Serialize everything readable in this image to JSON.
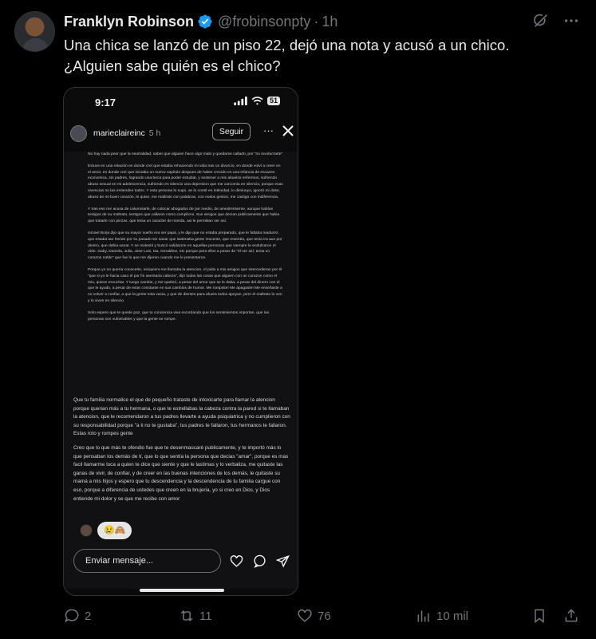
{
  "tweet": {
    "author_name": "Franklyn Robinson",
    "handle": "@frobinsonpty",
    "separator": "·",
    "time": "1h",
    "text_line1": "Una chica se lanzó de un piso 22, dejó una nota y acusó a un chico.",
    "text_line2": "¿Alguien sabe quién es el chico?"
  },
  "story": {
    "status_time": "9:17",
    "battery": "51",
    "username": "marieclaireinc",
    "time": "5 h",
    "follow_label": "Seguir",
    "more_label": "···",
    "note_paragraphs": [
      "No hay nada peor que la neutralidad, saber que alguien hace algo malo y quedarse callado, por \"no involucrarte\"",
      "Estuve en una relación en donde creí que estaba rehaciendo mi vida tras un divorcio, en donde volví a creer en el amor, en donde creí que iniciaba un nuevo capítulo despues de haber crecido en una infancia de escazes economica, sin padres, logrando una beca para poder estudiar, y sostener a mis abuelos enfermos, sufriendo abuso sexual en mi adolescencia, sufriendo en silencio una depresion que me carcomia en silencio, porque esas vivencias no las entienden todos. Y esta persona lo supo, se lo conté en intimidad, lo diminuyo, ignoró mi dolor, abuso de mi buen corazón, le quise, me maltrato con palabras, con malos gestos, me castigo con indiferencia.",
      "Y tras eso me acusa de calumniarle, de colocar abogados de por medio, de amedrentarme, aunque habían testigos de su maltrato, testigos que callaron como complices. Sus amigos que decian publicamente que habia que tratarle con pinzas, que tenia un caracter de mierda, asi le permitian ser así.",
      "Ismael Borja dijo que su mayor sueño era ser papá, y le dije que no estaba preparado, que le faltaba madurez, que estaba tan herido por su pasado sin sanar que lastimaba gente inocente, que resentía, que tenia ira aun por dentro, que debia sanar. Y se molestó y buscó validacion en aquellas personas que siempre le endulzaron el oído. Gaby, Daniela, Julia, Jose Luis, Isa, Geraldine, etc porque para ellos a pesar de \"él ser así, tenia un corazon noble\" que fue lo que me dijeron cuando me lo presentaron.",
      "Porque yo no quería conocerle, nisiquiera me llamaba la atencion, el pidio a mis amigos que intercedieran por él \"que si yo le hacia caso el por fin asentaria cabeza\", dijo todas las cosas que alguien con un corazon como el mio, quiere escuchar. Y luego cambio, y me quebró, a pesar del amor que se le daba, a pesar del dinero con el que le ayudo, a pesar de estar constante en sus cambios de humor. Me rompiste! Me apagaste! Me enseñaste a no volver a confiar, a que la gente esta vacia, y que de dientes para afuera todos apoyan, pero el maltrato lo ven y lo viven en silencio.",
      "Solo espero que te quede paz, que tu conciencia viva recordando que los sentimientos importan, que las personas son vulnerables y que la gente se rompe."
    ],
    "note_big_paragraphs": [
      "Que tu familia normalice el que de pequeño trataste de intoxicarte para llamar la atencion porque querian más a tu hermana, o que te estrellabas la cabeza contra la pared si te llamaban la atencion, que le recomendaron a tus padres llevarte a ayuda psiquiatrica y no cumplieron con su responsabilidad porque \"a ti no te gustaba\", tus padres te fallaron, tus hermanos te fallaron. Estas roto y rompes gente",
      "Creo que lo que más te ofendio fue que te desenmascaré publicamente, y te importó más lo que pensaban los demás de tí, que lo que sentía la persona que decias \"amar\", porque es mas facil llamarme loca a quien te dice que siente y que le lastimas y lo verbaliza, me quitaste las ganas de vivir, de confiar, y de creer en las buenas intenciones de los demás, le quitaste su mamá a mis hijos y espero que tu descendencia y la descendencia de tu familia cargue con eso, porque a diferencia de ustedes que creen en la brujeria, yo si creo en Dios, y Dios entiende mi dolor y se que me recibe con amor"
    ],
    "reaction_emojis": "😢🙈",
    "reply_placeholder": "Enviar mensaje..."
  },
  "actions": {
    "replies": "2",
    "retweets": "11",
    "likes": "76",
    "views": "10 mil"
  },
  "colors": {
    "background": "#000000",
    "text": "#e7e9ea",
    "muted": "#71767b",
    "verified": "#1d9bf0"
  },
  "icons": [
    "verified-badge-icon",
    "grok-icon",
    "more-icon",
    "signal-icon",
    "wifi-icon",
    "battery-icon",
    "close-icon",
    "heart-icon",
    "comment-icon",
    "send-icon",
    "reply-icon",
    "retweet-icon",
    "like-icon",
    "views-icon",
    "bookmark-icon",
    "share-icon"
  ]
}
